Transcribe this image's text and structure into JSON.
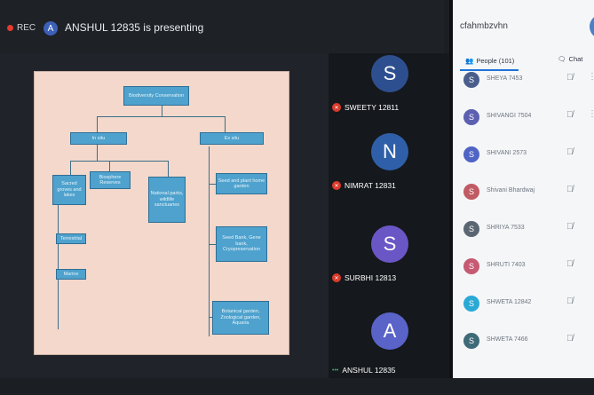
{
  "topbar": {
    "rec_label": "REC",
    "presenter_initial": "A",
    "presenting_text": "ANSHUL 12835 is presenting"
  },
  "slide": {
    "title": "Biodiversity Conservation",
    "in_situ": "In situ",
    "ex_situ": "Ex situ",
    "sacred": "Sacred groves and lakes",
    "biosphere": "Biosphere Reserves",
    "national": "National parks, wildlife sanctuaries",
    "terrestrial": "Terrestrial",
    "marine": "Marine",
    "seed_plant": "Seed and plant home garden",
    "seed_bank": "Seed Bank, Gene bank, Cryopreservation",
    "botanical": "Botanical garden, Zoological garden, Aquaria"
  },
  "tiles": [
    {
      "initial": "S",
      "name": "SWEETY 12811",
      "color": "#2e4f8f"
    },
    {
      "initial": "N",
      "name": "NIMRAT 12831",
      "color": "#2f5fa8"
    },
    {
      "initial": "S",
      "name": "SURBHI 12813",
      "color": "#6b56c6"
    },
    {
      "initial": "A",
      "name": "ANSHUL 12835",
      "color": "#5a63c8"
    }
  ],
  "panel": {
    "title": "cfahmbzvhn",
    "people_tab": "People (101)",
    "chat_tab": "Chat",
    "participants": [
      {
        "name": "SHEYA 7453",
        "initial": "S",
        "color": "#4a5e8c"
      },
      {
        "name": "SHIVANGI 7504",
        "initial": "S",
        "color": "#5d5fb1"
      },
      {
        "name": "SHIVANI 2573",
        "initial": "S",
        "color": "#4f64c4"
      },
      {
        "name": "Shivani Bhardwaj",
        "initial": "S",
        "color": "#c05b63"
      },
      {
        "name": "SHRIYA 7533",
        "initial": "S",
        "color": "#5b6673"
      },
      {
        "name": "SHRUTI 7403",
        "initial": "S",
        "color": "#c65a73"
      },
      {
        "name": "SHWETA 12842",
        "initial": "S",
        "color": "#2aa9d6"
      },
      {
        "name": "SHWETA 7466",
        "initial": "S",
        "color": "#3f6b79"
      }
    ]
  }
}
